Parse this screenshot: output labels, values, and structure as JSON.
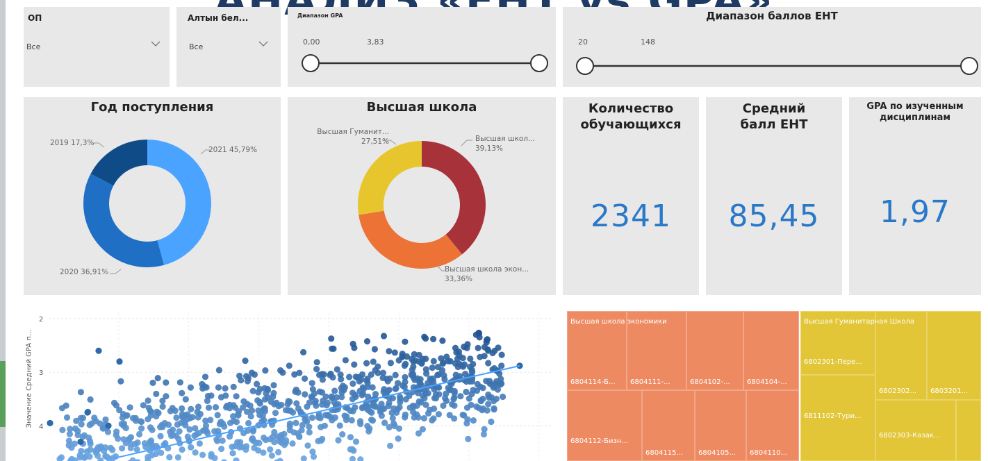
{
  "header": {
    "title": "АНАЛИЗ «ЕНТ vs GPA»"
  },
  "filters": {
    "op": {
      "label": "ОП",
      "value": "Все"
    },
    "altyn": {
      "label": "Алтын бел...",
      "value": "Все"
    },
    "gpa_range": {
      "label": "Диапазон GPA",
      "min": "0,00",
      "max": "3,83",
      "low_fraction": 0,
      "high_fraction": 1
    },
    "ent_range": {
      "label": "Диапазон баллов ЕНТ",
      "min": "20",
      "max": "148",
      "low_fraction": 0,
      "high_fraction": 1
    }
  },
  "donut_year": {
    "title": "Год поступления",
    "slices": [
      {
        "label": "2021 45,79%",
        "value": 45.79,
        "color": "#4aa3ff"
      },
      {
        "label": "2020 36,91%",
        "value": 36.91,
        "color": "#1f6fc4"
      },
      {
        "label": "2019 17,3%",
        "value": 17.3,
        "color": "#0f4c87"
      }
    ]
  },
  "donut_school": {
    "title": "Высшая школа",
    "slices": [
      {
        "label": "Высшая школ...",
        "value_label": "39,13%",
        "value": 39.13,
        "color": "#a8323a"
      },
      {
        "label": "Высшая школа экон...",
        "value_label": "33,36%",
        "value": 33.36,
        "color": "#ec7236"
      },
      {
        "label": "Высшая Гуманит...",
        "value_label": "27,51%",
        "value": 27.51,
        "color": "#e6c62c"
      }
    ]
  },
  "kpis": {
    "students": {
      "title": "Количество обучающихся",
      "value": "2341"
    },
    "ent_avg": {
      "title": "Средний балл ЕНТ",
      "value": "85,45"
    },
    "gpa": {
      "title": "GPA по изученным дисциплинам",
      "value": "1,97"
    }
  },
  "scatter": {
    "y_axis_label": "Значение Средний GPA п...",
    "y_ticks": [
      "4",
      "3",
      "2"
    ]
  },
  "chart_data": {
    "type": "scatter",
    "ylabel": "Значение Средний GPA п...",
    "ylim": [
      1.2,
      4
    ],
    "yticks": [
      2,
      3,
      4
    ],
    "trend_line": {
      "y_start": 1.4,
      "y_end": 3.12
    },
    "note": "point cloud of students: GPA (y) vs ЕНТ score (x)"
  },
  "treemap": {
    "groups": [
      {
        "name": "Высшая школа экономики",
        "color": "#ee8a62",
        "row1": [
          "6804114-Б...",
          "6804111-...",
          "6804102-...",
          "6804104-..."
        ],
        "row2": [
          "6804112-Бизн...",
          "6804115...",
          "6804105...",
          "6804110..."
        ]
      },
      {
        "name": "Высшая Гуманитарная Школа",
        "color": "#e2c637",
        "cells": [
          "6802301-Пере...",
          "6802302...",
          "6803201...",
          "6811102-Тури...",
          "6802303-Казак..."
        ]
      }
    ]
  }
}
